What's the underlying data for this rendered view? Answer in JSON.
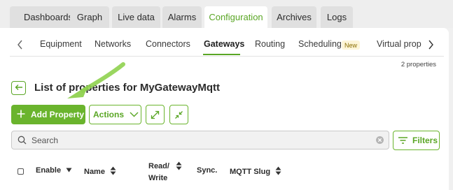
{
  "top_tabs": [
    {
      "label": "Dashboards",
      "active": false
    },
    {
      "label": "Graph",
      "active": false
    },
    {
      "label": "Live data",
      "active": false
    },
    {
      "label": "Alarms",
      "active": false
    },
    {
      "label": "Configuration",
      "active": true
    },
    {
      "label": "Archives",
      "active": false
    },
    {
      "label": "Logs",
      "active": false
    }
  ],
  "sub_nav": {
    "items": [
      {
        "label": "Equipment"
      },
      {
        "label": "Networks"
      },
      {
        "label": "Connectors"
      },
      {
        "label": "Gateways",
        "active": true
      },
      {
        "label": "Routing"
      },
      {
        "label": "Scheduling",
        "badge": "New"
      },
      {
        "label": "Virtual prop"
      }
    ]
  },
  "properties_count": "2 properties",
  "page_title": "List of properties for MyGatewayMqtt",
  "toolbar": {
    "add_property": "Add Property",
    "actions": "Actions"
  },
  "search": {
    "placeholder": "Search"
  },
  "filters_label": "Filters",
  "table": {
    "columns": [
      "Enable",
      "Name",
      "Read/",
      "Write",
      "Sync.",
      "MQTT Slug"
    ]
  },
  "colors": {
    "accent": "#6ab42d",
    "accent_text": "#5aa625"
  }
}
